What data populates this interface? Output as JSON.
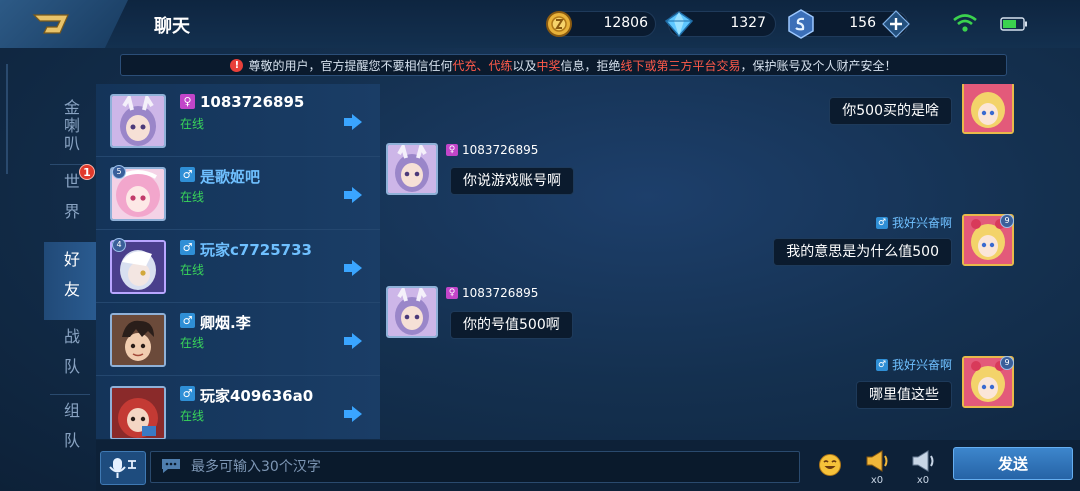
{
  "header": {
    "title": "聊天",
    "resources": [
      {
        "name": "gold",
        "value": "12806",
        "icon": "gold-coin-icon",
        "color": "#e8b23a"
      },
      {
        "name": "diamond",
        "value": "1327",
        "icon": "diamond-icon",
        "color": "#5fc8ff"
      },
      {
        "name": "voucher",
        "value": "156",
        "icon": "voucher-icon",
        "color": "#7ab6ff"
      }
    ],
    "add_icon": "plus-icon",
    "status_icons": [
      "wifi-icon",
      "battery-icon"
    ]
  },
  "notice": {
    "segments": [
      {
        "text": "尊敬的用户，官方提醒您不要相信任何",
        "color": "#d6e1ee"
      },
      {
        "text": "代充、代练",
        "color": "#ff5a4a"
      },
      {
        "text": "以及",
        "color": "#d6e1ee"
      },
      {
        "text": "中奖",
        "color": "#ff5a4a"
      },
      {
        "text": "信息，拒绝",
        "color": "#d6e1ee"
      },
      {
        "text": "线下或第三方平台交易",
        "color": "#ff5a4a"
      },
      {
        "text": "，保护账号及个人财产安全！",
        "color": "#d6e1ee"
      }
    ]
  },
  "channels": [
    {
      "label": "金喇叭",
      "active": false,
      "badge": ""
    },
    {
      "label": "世界",
      "active": false,
      "badge": "1"
    },
    {
      "label": "好友",
      "active": true,
      "badge": ""
    },
    {
      "label": "战队",
      "active": false,
      "badge": ""
    },
    {
      "label": "组队",
      "active": false,
      "badge": ""
    }
  ],
  "friends": [
    {
      "name": "1083726895",
      "gender": "female",
      "status": "在线",
      "level": ""
    },
    {
      "name": "是歌姬吧",
      "gender": "male",
      "status": "在线",
      "level": "5"
    },
    {
      "name": "玩家c7725733",
      "gender": "male",
      "status": "在线",
      "level": "4"
    },
    {
      "name": "卿烟.李",
      "gender": "male",
      "status": "在线",
      "level": ""
    },
    {
      "name": "玩家409636a0",
      "gender": "male",
      "status": "在线",
      "level": ""
    }
  ],
  "messages": [
    {
      "side": "out",
      "sender": "",
      "text": "你500买的是啥"
    },
    {
      "side": "in",
      "sender": "1083726895",
      "text": "你说游戏账号啊"
    },
    {
      "side": "out",
      "sender": "我好兴奋啊",
      "text": "我的意思是为什么值500"
    },
    {
      "side": "in",
      "sender": "1083726895",
      "text": "你的号值500啊"
    },
    {
      "side": "out",
      "sender": "我好兴奋啊",
      "text": "哪里值这些"
    }
  ],
  "input": {
    "placeholder": "最多可输入30个汉字",
    "send_label": "发送",
    "horn_gold_count": "x0",
    "horn_silver_count": "x0"
  }
}
